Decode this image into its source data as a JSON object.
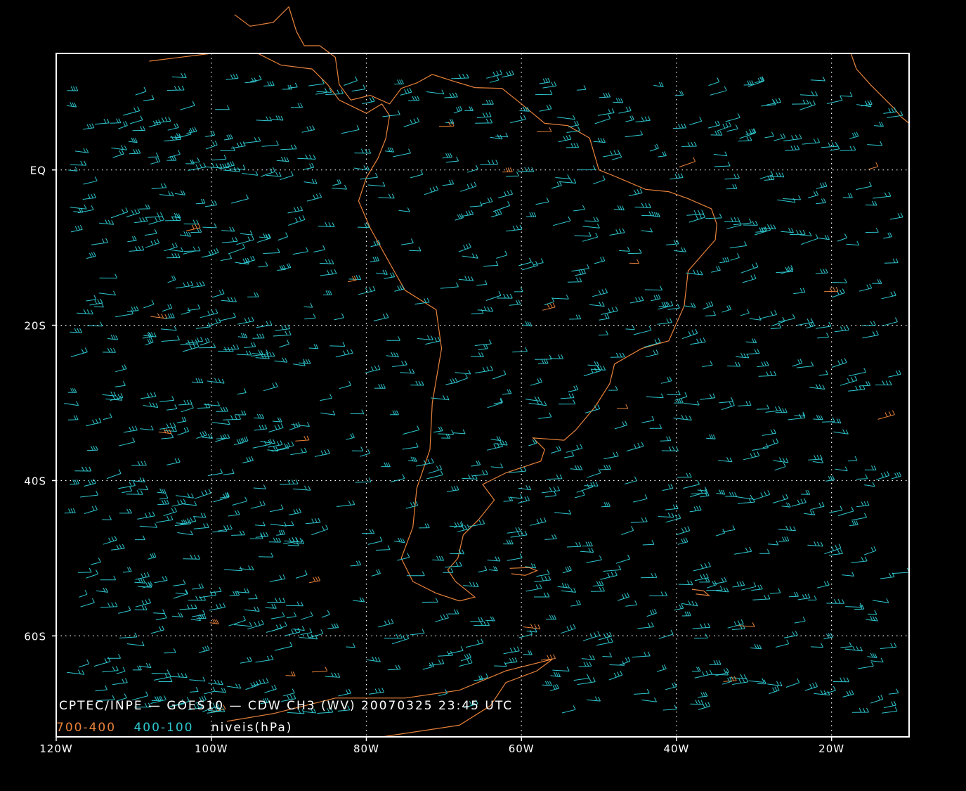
{
  "map": {
    "projection": "lat-lon",
    "lon_range": [
      -120,
      -10
    ],
    "lat_range": [
      -73,
      15
    ],
    "x_tick_labels": [
      {
        "lon": -120,
        "label": "120W"
      },
      {
        "lon": -100,
        "label": "100W"
      },
      {
        "lon": -80,
        "label": "80W"
      },
      {
        "lon": -60,
        "label": "60W"
      },
      {
        "lon": -40,
        "label": "40W"
      },
      {
        "lon": -20,
        "label": "20W"
      }
    ],
    "y_tick_labels": [
      {
        "lat": 0,
        "label": "EQ"
      },
      {
        "lat": -20,
        "label": "20S"
      },
      {
        "lat": -40,
        "label": "40S"
      },
      {
        "lat": -60,
        "label": "60S"
      }
    ],
    "grid": true,
    "colors": {
      "background": "#000000",
      "frame": "#ffffff",
      "grid": "#ffffff",
      "coastline": "#e8823a",
      "low_level_vectors": "#e8823a",
      "upper_level_vectors": "#2ec8d0"
    }
  },
  "caption": {
    "line1": "CPTEC/INPE — GOES10 — CDW CH3 (WV) 20070325 23:45 UTC",
    "legend_low": "700-400",
    "legend_high": "400-100",
    "legend_unit": "niveis(hPa)"
  }
}
